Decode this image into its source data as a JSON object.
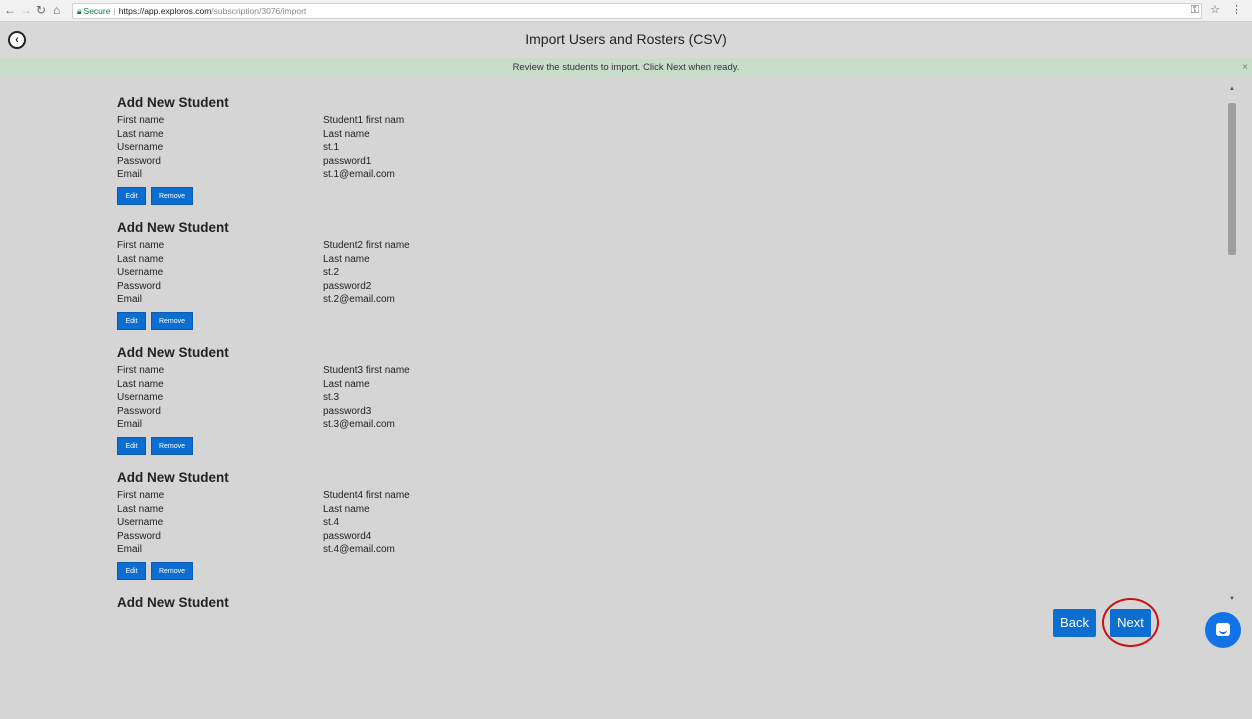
{
  "browser": {
    "secure_label": "Secure",
    "url_host": "https://app.exploros.com",
    "url_path": "/subscription/3076/import",
    "right_icons": "⚿ ☆ ⋮"
  },
  "header": {
    "title": "Import Users and Rosters (CSV)",
    "back_icon": "‹"
  },
  "banner": {
    "message": "Review the students to import. Click Next when ready.",
    "close": "×"
  },
  "labels": {
    "section_title": "Add New Student",
    "first_name": "First name",
    "last_name": "Last name",
    "username": "Username",
    "password": "Password",
    "email": "Email",
    "edit": "Edit",
    "remove": "Remove"
  },
  "students": [
    {
      "first_name": "Student1 first nam",
      "last_name": "Last name",
      "username": "st.1",
      "password": "password1",
      "email": "st.1@email.com"
    },
    {
      "first_name": "Student2 first name",
      "last_name": "Last name",
      "username": "st.2",
      "password": "password2",
      "email": "st.2@email.com"
    },
    {
      "first_name": "Student3 first name",
      "last_name": "Last name",
      "username": "st.3",
      "password": "password3",
      "email": "st.3@email.com"
    },
    {
      "first_name": "Student4 first name",
      "last_name": "Last name",
      "username": "st.4",
      "password": "password4",
      "email": "st.4@email.com"
    }
  ],
  "footer": {
    "back": "Back",
    "next": "Next"
  }
}
